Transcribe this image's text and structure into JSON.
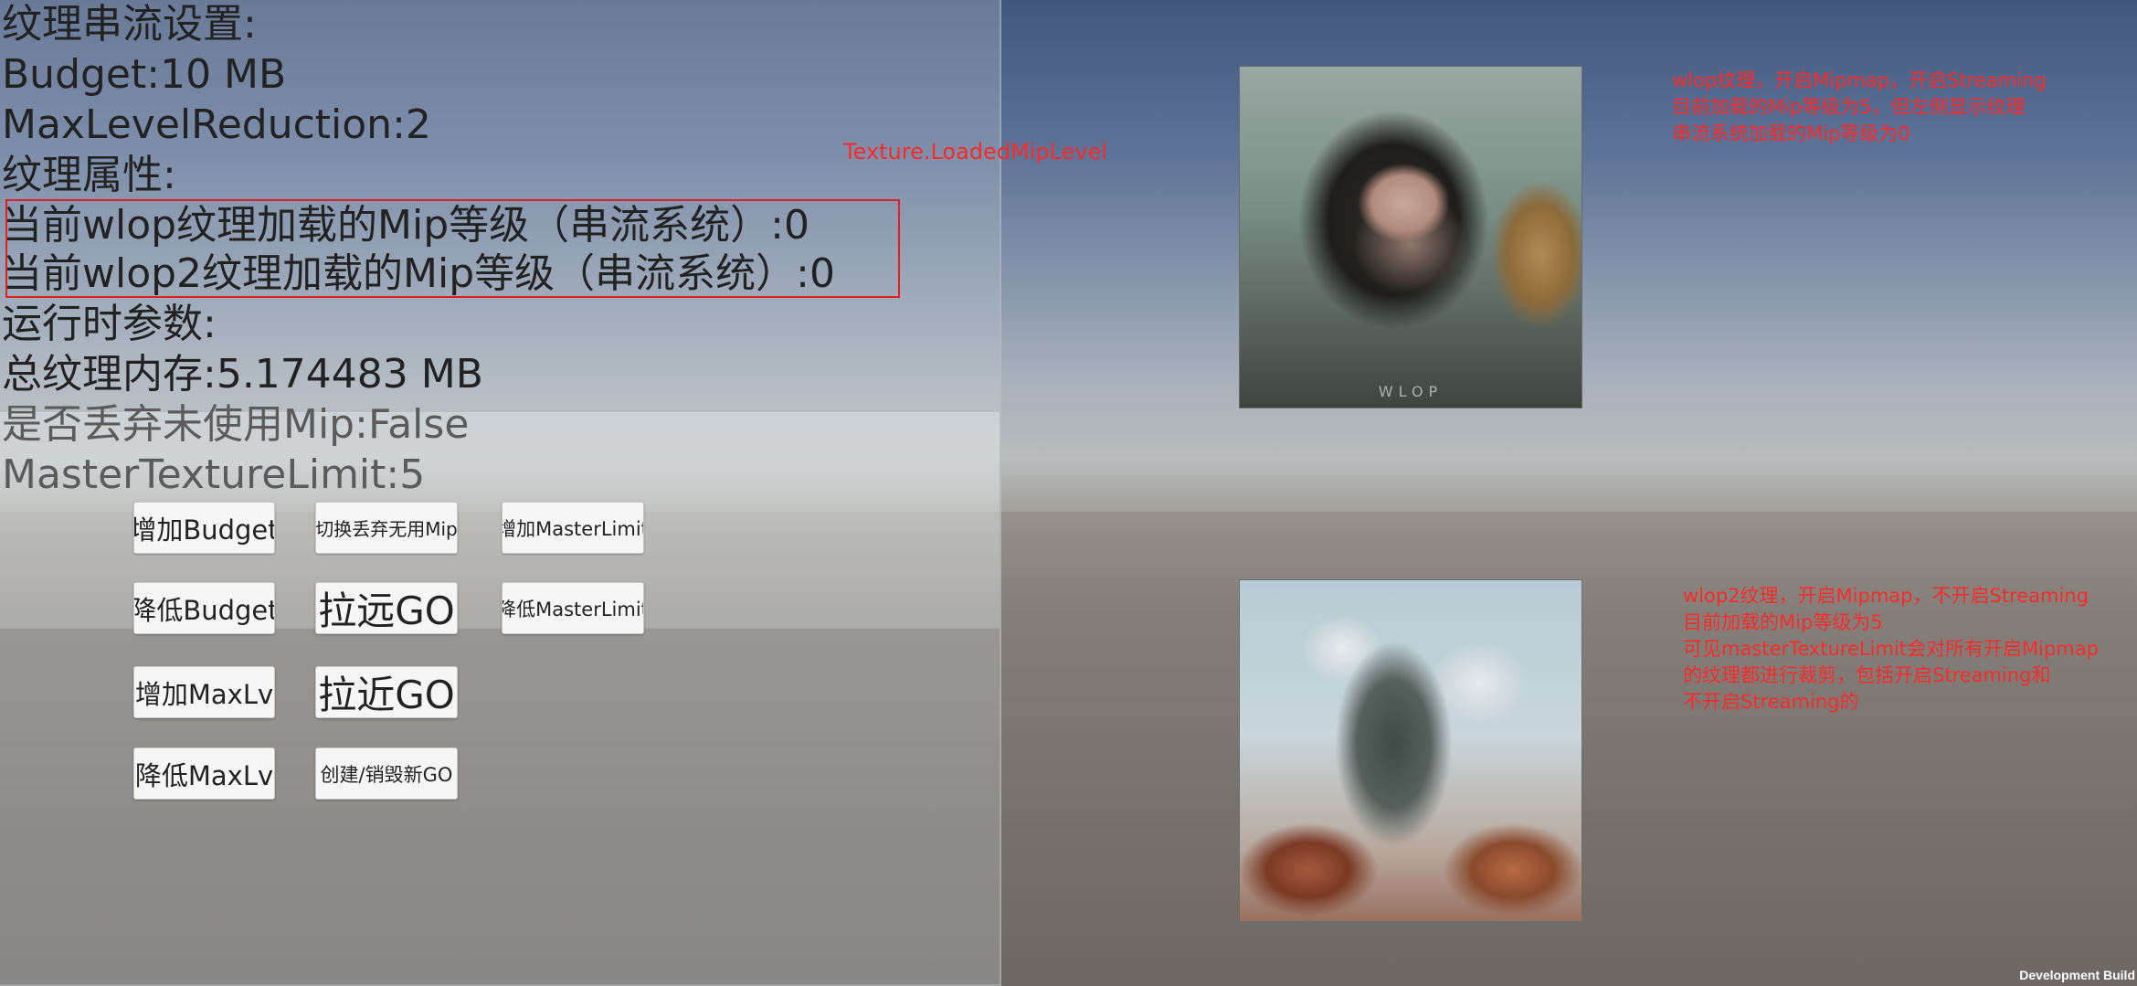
{
  "panel": {
    "lines": [
      "纹理串流设置:",
      "Budget:10 MB",
      "MaxLevelReduction:2",
      "纹理属性:",
      "当前wlop纹理加载的Mip等级（串流系统）:0",
      "当前wlop2纹理加载的Mip等级（串流系统）:0",
      "运行时参数:",
      "总纹理内存:5.174483 MB",
      "是否丢弃未使用Mip:False",
      "MasterTextureLimit:5"
    ]
  },
  "buttons": {
    "add_budget": "增加Budget",
    "toggle_discard": "切换丢弃无用Mip",
    "add_master_limit": "增加MasterLimit",
    "reduce_budget": "降低Budget",
    "pull_far": "拉远GO",
    "reduce_master_limit": "降低MasterLimit",
    "add_max_lv": "增加MaxLv",
    "pull_near": "拉近GO",
    "reduce_max_lv": "降低MaxLv",
    "create_destroy": "创建/销毁新GO"
  },
  "annotations": {
    "loaded_mip_label": "Texture.LoadedMipLevel",
    "note1": [
      "wlop纹理，开启Mipmap，开启Streaming",
      "目前加载的Mip等级为5，但左侧显示纹理",
      "串流系统加载的Mip等级为0"
    ],
    "note2": [
      "wlop2纹理，开启Mipmap，不开启Streaming",
      "目前加载的Mip等级为5",
      "可见masterTextureLimit会对所有开启Mipmap",
      "的纹理都进行裁剪，包括开启Streaming和",
      "不开启Streaming的"
    ]
  },
  "images": {
    "img1_caption": "WLOP"
  },
  "footer": {
    "dev_build": "Development Build"
  },
  "colors": {
    "annotation_red": "#ff2a2a",
    "highlight_border": "#e02020"
  }
}
